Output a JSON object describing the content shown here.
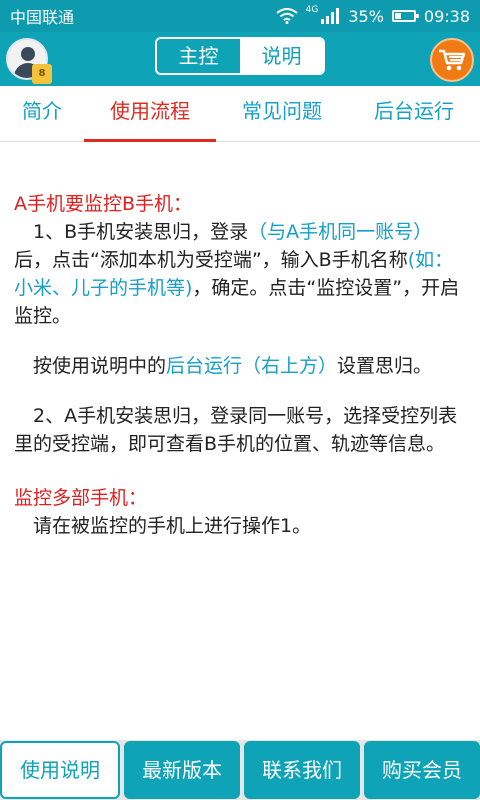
{
  "status_bar": {
    "carrier": "中国联通",
    "network": "4G",
    "battery": "35%",
    "time": "09:38"
  },
  "header": {
    "avatar_badge": "8",
    "segments": [
      {
        "label": "主控",
        "active": false
      },
      {
        "label": "说明",
        "active": true
      }
    ]
  },
  "tabs": [
    {
      "label": "简介",
      "active": false
    },
    {
      "label": "使用流程",
      "active": true
    },
    {
      "label": "常见问题",
      "active": false
    },
    {
      "label": "后台运行",
      "active": false
    }
  ],
  "content": {
    "heading1": "A手机要监控B手机：",
    "para1_a": "　1、B手机安装思归，登录",
    "para1_b": "（与A手机同一账号）",
    "para1_c": "后，点击“添加本机为受控端”，输入B手机名称",
    "para1_d": "(如：小米、儿子的手机等)",
    "para1_e": "，确定。点击“监控设置”，开启监控。",
    "para2_a": "　按使用说明中的",
    "para2_b": "后台运行（右上方）",
    "para2_c": "设置思归。",
    "para3": "　2、A手机安装思归，登录同一账号，选择受控列表里的受控端，即可查看B手机的位置、轨迹等信息。",
    "heading2": "监控多部手机：",
    "para4": "　请在被监控的手机上进行操作1。"
  },
  "bottom_bar": [
    {
      "label": "使用说明",
      "active": true
    },
    {
      "label": "最新版本",
      "active": false
    },
    {
      "label": "联系我们",
      "active": false
    },
    {
      "label": "购买会员",
      "active": false
    }
  ],
  "colors": {
    "primary": "#0fa3b8",
    "accent_red": "#e02020",
    "link_blue": "#16a0c8",
    "cart_orange": "#f07a14"
  },
  "battery_level": 0.35
}
